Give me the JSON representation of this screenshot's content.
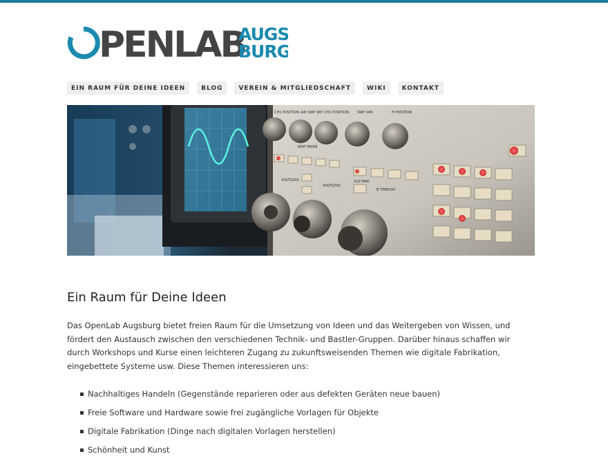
{
  "logo": {
    "part1": "PENLAB",
    "part2_top": "AUGS",
    "part2_bottom": "BURG"
  },
  "colors": {
    "accent": "#1a7a9a",
    "logo_dark": "#444444",
    "logo_blue": "#1a8aae"
  },
  "nav": [
    {
      "label": "EIN RAUM FÜR DEINE IDEEN"
    },
    {
      "label": "BLOG"
    },
    {
      "label": "VEREIN & MITGLIEDSCHAFT"
    },
    {
      "label": "WIKI"
    },
    {
      "label": "KONTAKT"
    }
  ],
  "hero": {
    "labels": [
      "CH1 POSITION",
      "A/B SWP SEP",
      "CH2 POSITION",
      "SWP VAR",
      "H POSITION",
      "VERT MODE",
      "VOLTS/DIV",
      "VOLTS/DIV",
      "B TIME/DIV",
      "X10 MAG"
    ]
  },
  "content": {
    "heading": "Ein Raum für Deine Ideen",
    "intro": "Das OpenLab Augsburg bietet freien Raum für die Umsetzung von Ideen und das Weitergeben von Wissen, und fördert den Austausch zwischen den verschiedenen Technik- und Bastler-Gruppen. Darüber hinaus schaffen wir durch Workshops und Kurse einen leichteren Zugang zu zukunftsweisenden Themen wie digitale Fabrikation, eingebettete Systeme usw. Diese Themen interessieren uns:",
    "topics": [
      "Nachhaltiges Handeln (Gegenstände reparieren oder aus defekten Geräten neue bauen)",
      "Freie Software und Hardware sowie frei zugängliche Vorlagen für Objekte",
      "Digitale Fabrikation (Dinge nach digitalen Vorlagen herstellen)",
      "Schönheit und Kunst"
    ]
  }
}
